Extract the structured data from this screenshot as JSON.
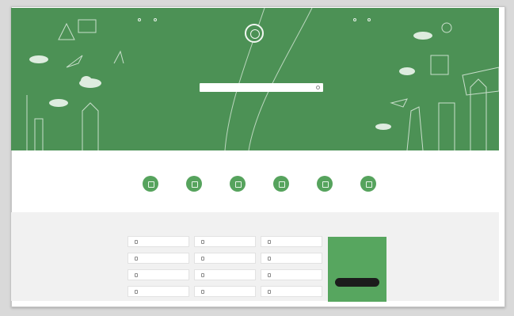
{
  "page": {
    "colors": {
      "hero_green": "#4c9155",
      "accent_green": "#56a35d",
      "link_blue": "#3d8bd1",
      "button_dark": "#1c1c1c"
    }
  },
  "topnav": {
    "left": [
      {
        "label": "",
        "icon": "info-icon"
      },
      {
        "label": "",
        "icon": "help-icon"
      }
    ],
    "right": [
      {
        "label": "",
        "icon": "user-icon"
      },
      {
        "label": "",
        "icon": "login-icon"
      }
    ]
  },
  "hero": {
    "logo_icon": "emblem-icon",
    "title": "",
    "search": {
      "value": "",
      "placeholder": "",
      "icon": "search-icon"
    }
  },
  "quick_links": {
    "title": "",
    "items": [
      {
        "label": "",
        "icon": "service-icon"
      },
      {
        "label": "",
        "icon": "service-icon"
      },
      {
        "label": "",
        "icon": "service-icon"
      },
      {
        "label": "",
        "icon": "service-icon"
      },
      {
        "label": "",
        "icon": "service-icon"
      },
      {
        "label": "",
        "icon": "service-icon"
      }
    ]
  },
  "popular": {
    "title": "",
    "items": [
      {
        "label": "",
        "icon": "document-icon"
      },
      {
        "label": "",
        "icon": "document-icon"
      },
      {
        "label": "",
        "icon": "document-icon"
      },
      {
        "label": "",
        "icon": "document-icon"
      },
      {
        "label": "",
        "icon": "document-icon"
      },
      {
        "label": "",
        "icon": "document-icon"
      },
      {
        "label": "",
        "icon": "document-icon"
      },
      {
        "label": "",
        "icon": "document-icon"
      },
      {
        "label": "",
        "icon": "document-icon"
      },
      {
        "label": "",
        "icon": "document-icon"
      },
      {
        "label": "",
        "icon": "document-icon"
      },
      {
        "label": "",
        "icon": "document-icon"
      }
    ]
  },
  "promo": {
    "heading": "",
    "text": "",
    "button_label": "",
    "link_label": ""
  }
}
